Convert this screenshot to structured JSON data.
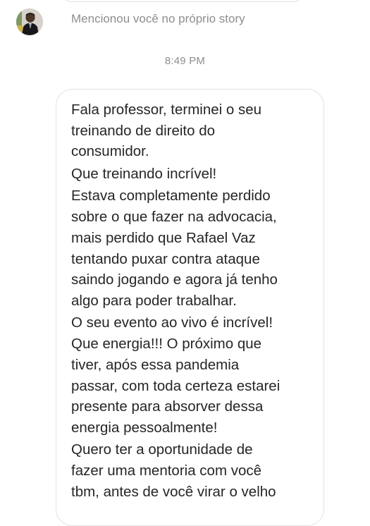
{
  "story_mention": {
    "avatar_icon": "user-avatar-icon",
    "text": "Mencionou você no próprio story"
  },
  "timestamp": "8:49 PM",
  "message": {
    "paragraphs": [
      {
        "lines": [
          "Fala professor, terminei o seu",
          "treinando de direito do",
          "consumidor."
        ]
      },
      {
        "lines": [
          "Que treinando incrível!"
        ]
      },
      {
        "lines": [
          "Estava completamente perdido",
          "sobre o que fazer na advocacia,",
          "mais perdido que Rafael Vaz",
          "tentando puxar contra ataque",
          "saindo jogando e agora já tenho",
          "algo para poder trabalhar."
        ]
      },
      {
        "lines": [
          "O seu evento ao vivo é incrível!",
          "Que energia!!! O próximo que",
          "tiver, após essa pandemia",
          "passar, com toda certeza estarei",
          "presente para absorver dessa",
          "energia pessoalmente!"
        ]
      },
      {
        "lines": [
          "Quero ter a oportunidade de",
          "fazer uma mentoria com você",
          "tbm, antes de você virar o velho"
        ]
      }
    ]
  },
  "colors": {
    "text_primary": "#262626",
    "text_secondary": "#8e8e8e",
    "bubble_border": "#e3e3e3",
    "background": "#ffffff"
  }
}
